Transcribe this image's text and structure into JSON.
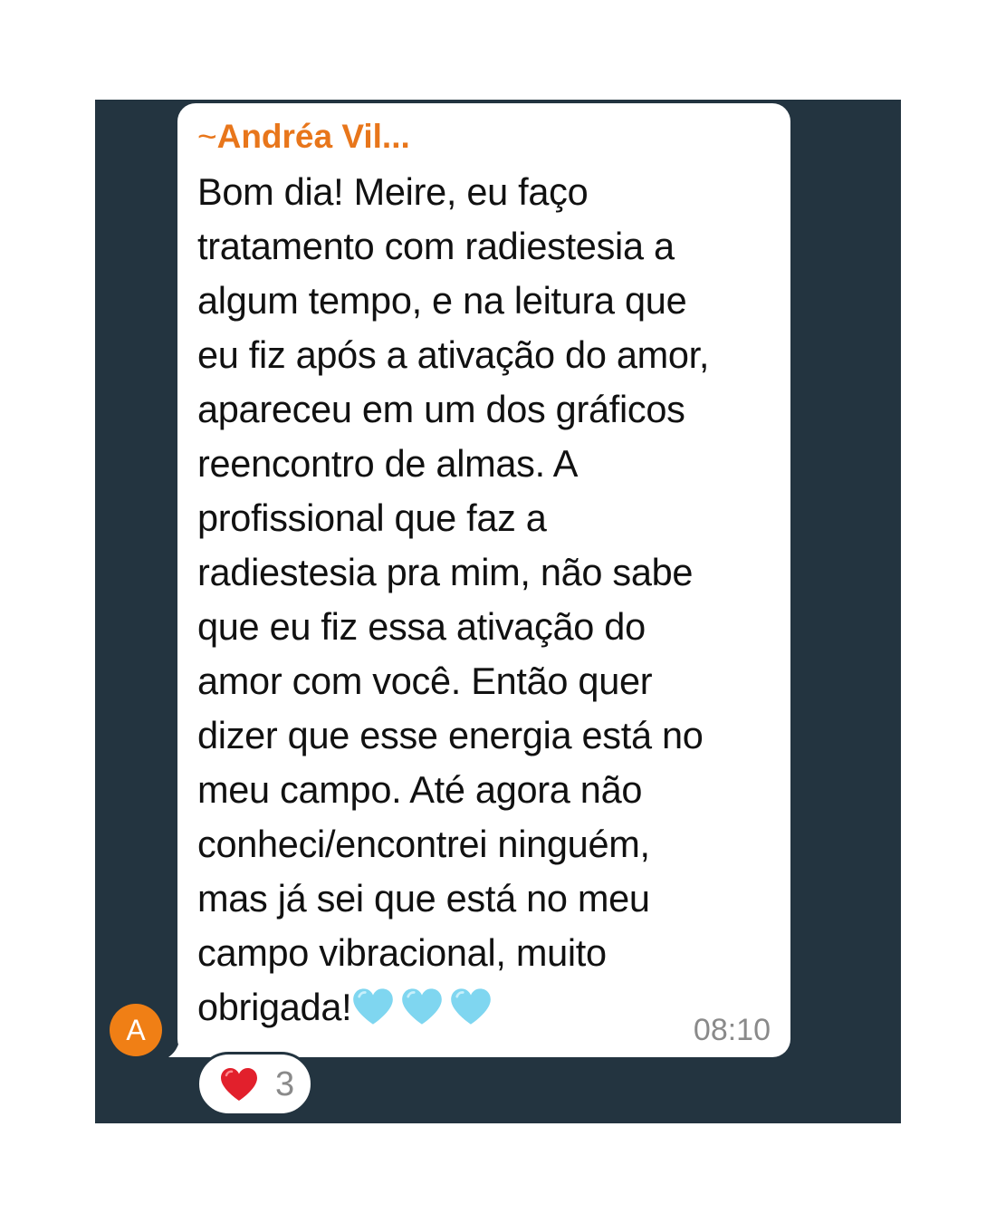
{
  "chat": {
    "background_color": "#233440"
  },
  "message": {
    "sender_prefix": "~",
    "sender_name": "Andréa Vil...",
    "sender_color": "#e8761b",
    "text": "Bom dia! Meire, eu faço\ntratamento com radiestesia a\nalgum tempo, e na leitura que\neu fiz após a ativação do amor,\napareceu em um dos gráficos\nreencontro de almas. A\nprofissional que faz a\nradiestesia pra mim, não sabe\nque eu fiz essa ativação do\namor com você. Então quer\ndizer que esse energia está no\nmeu campo. Até agora não\nconheci/encontrei ninguém,\nmas já sei que está no meu\ncampo vibracional, muito\nobrigada!",
    "trailing_emojis": [
      "light-blue-heart-icon",
      "light-blue-heart-icon",
      "light-blue-heart-icon"
    ],
    "timestamp": "08:10"
  },
  "avatar": {
    "initial": "A",
    "color": "#f07f15"
  },
  "reaction": {
    "emoji": "red-heart-icon",
    "count": "3"
  }
}
